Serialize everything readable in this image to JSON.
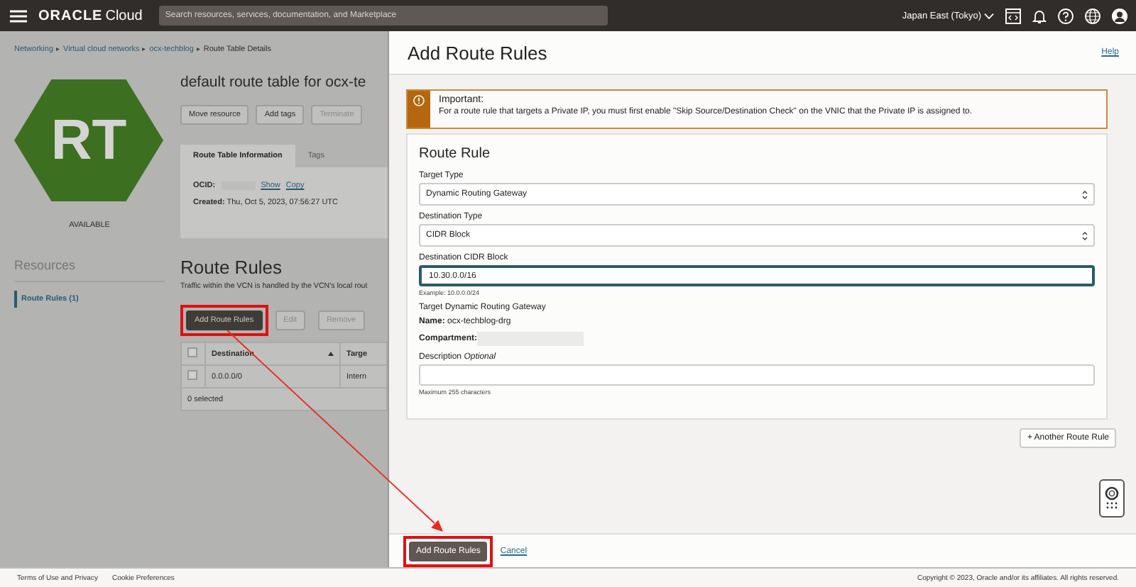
{
  "topbar": {
    "brand": "ORACLE",
    "brand_suffix": "Cloud",
    "search": {
      "placeholder": "Search resources, services, documentation, and Marketplace"
    },
    "region": "Japan East (Tokyo)"
  },
  "breadcrumb": {
    "separator": "▸",
    "items": [
      {
        "label": "Networking",
        "link": true
      },
      {
        "label": "Virtual cloud networks",
        "link": true
      },
      {
        "label": "ocx-techblog",
        "link": true
      },
      {
        "label": "Route Table Details",
        "link": false
      }
    ]
  },
  "resource": {
    "badge": "RT",
    "status": "AVAILABLE",
    "title": "default route table for ocx-te",
    "actions": [
      {
        "label": "Move resource",
        "disabled": false
      },
      {
        "label": "Add tags",
        "disabled": false
      },
      {
        "label": "Terminate",
        "disabled": true
      }
    ],
    "tabs": [
      {
        "label": "Route Table Information",
        "selected": true
      },
      {
        "label": "Tags",
        "selected": false
      }
    ],
    "info": {
      "ocid_label": "OCID:",
      "ocid_redacted": true,
      "ocid_links": [
        "Show",
        "Copy"
      ],
      "created": "**Created:** Thu, Oct 5, 2023, 07:56:27 UTC"
    }
  },
  "resources": {
    "title": "Resources",
    "items": [
      {
        "label": "Route Rules (1)",
        "selected": true
      }
    ]
  },
  "route_rules": {
    "title": "Route Rules",
    "description": "Traffic within the VCN is handled by the VCN's local rout",
    "buttons": [
      {
        "label": "Add Route Rules",
        "kind": "primary",
        "disabled": false,
        "highlighted": true
      },
      {
        "label": "Edit",
        "kind": "secondary",
        "disabled": true,
        "highlighted": false
      },
      {
        "label": "Remove",
        "kind": "secondary",
        "disabled": true,
        "highlighted": false
      }
    ],
    "header_checked": false,
    "columns": [
      {
        "label": "Destination",
        "sorted": true
      },
      {
        "label": "Targe",
        "sorted": false
      }
    ],
    "rows": [
      {
        "checked": false,
        "cells": [
          "0.0.0.0/0",
          "Intern"
        ]
      }
    ],
    "footer": "0 selected"
  },
  "panel": {
    "title": "Add Route Rules",
    "help": "Help",
    "alert": {
      "title": "Important:",
      "text": "For a route rule that targets a Private IP, you must first enable \"Skip Source/Destination Check\" on the VNIC that the Private IP is assigned to."
    },
    "rule": {
      "title": "Route Rule",
      "fields": [
        {
          "kind": "select",
          "label": "Target Type",
          "value": "Dynamic Routing Gateway"
        },
        {
          "kind": "select",
          "label": "Destination Type",
          "value": "CIDR Block"
        },
        {
          "kind": "input",
          "label": "Destination CIDR Block",
          "value": "10.30.0.0/16",
          "focused": true,
          "hint": "Example: 10.0.0.0/24"
        },
        {
          "kind": "info",
          "label": "Target Dynamic Routing Gateway",
          "entries": [
            {
              "text": "**Name:** ocx-techblog-drg",
              "redacted": false
            },
            {
              "text": "**Compartment:**",
              "redacted": true
            }
          ]
        },
        {
          "kind": "input",
          "label": "Description *Optional*",
          "focused": false,
          "hint": "Maximum 255 characters"
        }
      ]
    },
    "another": "+ Another Route Rule",
    "submit": {
      "label": "Add Route Rules",
      "highlighted": true
    },
    "cancel": "Cancel"
  },
  "footer": {
    "links": [
      "Terms of Use and Privacy",
      "Cookie Preferences"
    ],
    "copyright": "Copyright © 2023, Oracle and/or its affiliates. All rights reserved."
  }
}
